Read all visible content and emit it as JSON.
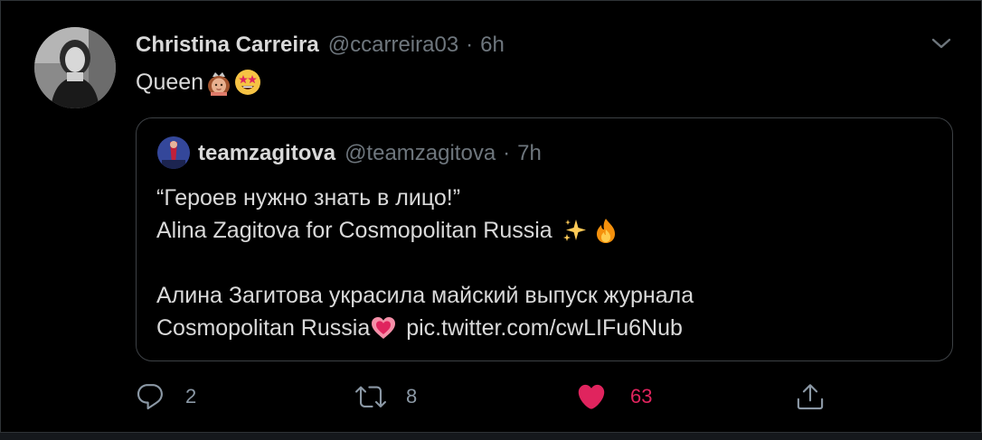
{
  "tweet": {
    "author_name": "Christina Carreira",
    "author_handle": "@ccarreira03",
    "separator": "·",
    "time": "6h",
    "text": "Queen",
    "emojis": [
      "princess-emoji",
      "star-struck-emoji"
    ]
  },
  "quoted_tweet": {
    "author_name": "teamzagitova",
    "author_handle": "@teamzagitova",
    "separator": "·",
    "time": "7h",
    "line1": "“Героев нужно знать в лицо!”",
    "line2": "Alina Zagitova for Cosmopolitan Russia",
    "line2_emojis": [
      "sparkles-emoji",
      "fire-emoji"
    ],
    "line3": "Алина Загитова украсила майский выпуск журнала",
    "line4_text": "Cosmopolitan Russia",
    "line4_emoji": "heart-emoji",
    "line4_link": "pic.twitter.com/cwLIFu6Nub"
  },
  "actions": {
    "reply_count": "2",
    "retweet_count": "8",
    "like_count": "63"
  },
  "colors": {
    "background": "#000000",
    "primary_text": "#d9d9d9",
    "secondary_text": "#6e767d",
    "like_accent": "#e0245e",
    "border": "#2f3336"
  }
}
